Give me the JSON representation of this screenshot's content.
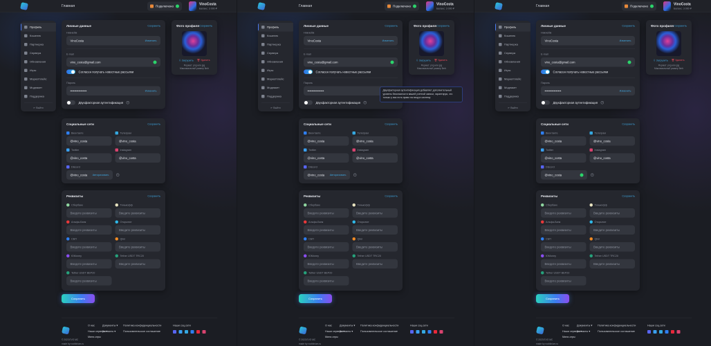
{
  "header": {
    "home": "Главная",
    "connection": "Подключено",
    "username": "VinoCosta",
    "balance": "Баланс: 3 000 ₽"
  },
  "sidebar": {
    "items": [
      "Профиль",
      "Кошелек",
      "Партнерка",
      "Сервера",
      "Обновления",
      "Игры",
      "Маркетплейс",
      "Модпакет",
      "Поддержка"
    ],
    "logout": "Выйти"
  },
  "personal": {
    "title": "Личные данные",
    "save": "Сохранить",
    "nick_label": "Никнейм",
    "nick": "VinoCosta",
    "change": "Изменить",
    "email_label": "E-mail",
    "email": "vino_costa@gmail.com",
    "newsletter": "Согласен получать новостные рассылки",
    "password_label": "Пароль",
    "password": "••••••••••••••••",
    "twofa": "Двухфакторная аутентификация",
    "twofa_tooltip": "Двухфакторная аутентификация добавляет дополнительный уровень безопасности вашей учетной записи, гарантируя, что только у вас есть право на вход в систему"
  },
  "photo": {
    "title": "Фото профиля",
    "save": "Сохранить",
    "upload": "Загрузить",
    "delete": "Удалить",
    "note": "Формат: png или jpg Максимальный размер 5mb"
  },
  "social": {
    "title": "Социальные сети",
    "save": "Сохранить",
    "authorize": "Авторизовать",
    "items": [
      {
        "name": "Вконтакте",
        "value": "@vino_costa",
        "color": "#2f7ff0"
      },
      {
        "name": "Телеграм",
        "value": "@vino_costa",
        "color": "#35a8e0"
      },
      {
        "name": "Twitter",
        "value": "@vino_costa",
        "color": "#3aa0f0"
      },
      {
        "name": "Instagram",
        "value": "@vino_costa",
        "color": "#d9436f"
      },
      {
        "name": "Discord",
        "value": "@vino_costa",
        "color": "#5865f2"
      }
    ]
  },
  "requisites": {
    "title": "Реквизиты",
    "save": "Сохранить",
    "placeholder": "Введите реквизиты",
    "items": [
      {
        "name": "Сбербанк",
        "color": "#8fd6a0"
      },
      {
        "name": "Тинькофф",
        "color": "#e8e3c0"
      },
      {
        "name": "Альфа-Банк",
        "color": "#e8383a"
      },
      {
        "name": "Открытие",
        "color": "#2fb8e8"
      },
      {
        "name": "СБП",
        "color": "#2f7ff0"
      },
      {
        "name": "Qiwi",
        "color": "#f08a24"
      },
      {
        "name": "ЮMoney",
        "color": "#8a4ef0"
      },
      {
        "name": "Tether USDT TRC20",
        "color": "#26a17b"
      },
      {
        "name": "Tether USDT BEP20",
        "color": "#26a17b"
      }
    ]
  },
  "save_button": "Сохранить",
  "footer": {
    "copyright": "© 2023 EVO MC",
    "made_by": "made by rooblinium.ru",
    "links": [
      "О нас",
      "Наши сервера ▾",
      "Мини-игры",
      "Документы ▾",
      "Контакты ▾",
      "Политика конфиденциальности",
      "Пользовательское соглашение"
    ],
    "social_title": "Наши соц.сети",
    "social_colors": [
      "#5865f2",
      "#3aa0f0",
      "#35a8e0",
      "#2f7ff0",
      "#e8283a",
      "#d9436f"
    ]
  },
  "variants": [
    {
      "tooltip": false,
      "discord_verified": false
    },
    {
      "tooltip": true,
      "discord_verified": false
    },
    {
      "tooltip": false,
      "discord_verified": true
    }
  ]
}
